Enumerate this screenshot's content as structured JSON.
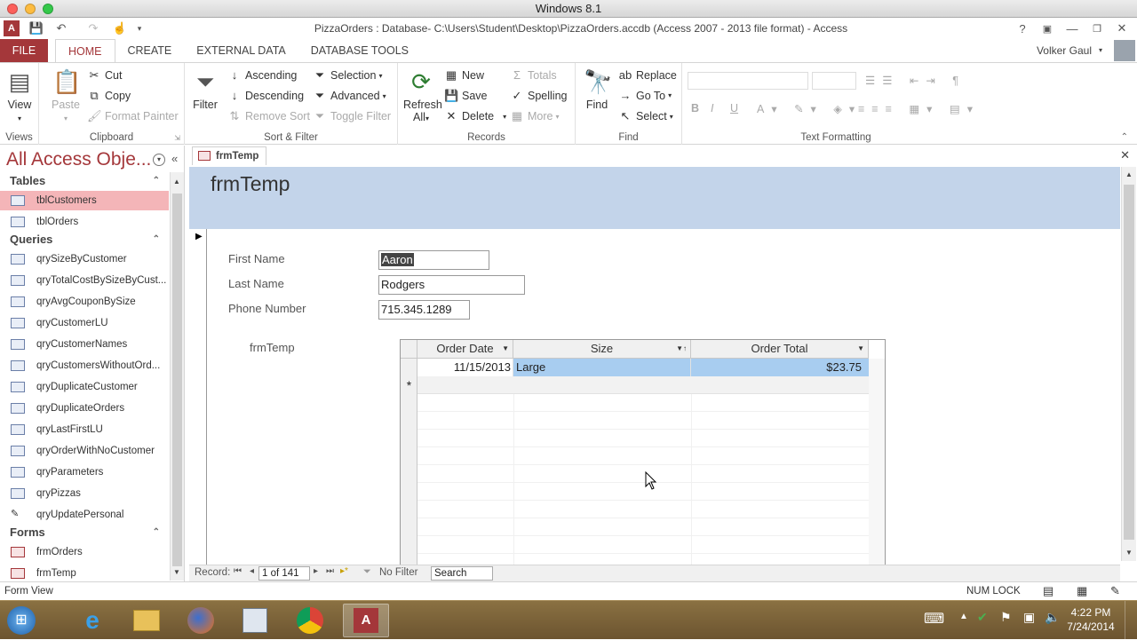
{
  "os_window_title": "Windows 8.1",
  "app_title": "PizzaOrders : Database- C:\\Users\\Student\\Desktop\\PizzaOrders.accdb (Access 2007 - 2013 file format) - Access",
  "user": "Volker Gaul",
  "tabs": [
    "FILE",
    "HOME",
    "CREATE",
    "EXTERNAL DATA",
    "DATABASE TOOLS"
  ],
  "ribbon": {
    "views": {
      "label": "Views",
      "view": "View"
    },
    "clipboard": {
      "label": "Clipboard",
      "paste": "Paste",
      "cut": "Cut",
      "copy": "Copy",
      "format_painter": "Format Painter"
    },
    "sort_filter": {
      "label": "Sort & Filter",
      "filter": "Filter",
      "ascending": "Ascending",
      "descending": "Descending",
      "remove_sort": "Remove Sort",
      "selection": "Selection",
      "advanced": "Advanced",
      "toggle_filter": "Toggle Filter"
    },
    "records": {
      "label": "Records",
      "refresh": "Refresh",
      "refresh2": "All",
      "new": "New",
      "save": "Save",
      "delete": "Delete",
      "totals": "Totals",
      "spelling": "Spelling",
      "more": "More"
    },
    "find": {
      "label": "Find",
      "find": "Find",
      "replace": "Replace",
      "goto": "Go To",
      "select": "Select"
    },
    "text_formatting": {
      "label": "Text Formatting"
    }
  },
  "nav": {
    "title": "All Access Obje...",
    "tables_header": "Tables",
    "tables": [
      "tblCustomers",
      "tblOrders"
    ],
    "queries_header": "Queries",
    "queries": [
      "qrySizeByCustomer",
      "qryTotalCostBySizeByCust...",
      "qryAvgCouponBySize",
      "qryCustomerLU",
      "qryCustomerNames",
      "qryCustomersWithoutOrd...",
      "qryDuplicateCustomer",
      "qryDuplicateOrders",
      "qryLastFirstLU",
      "qryOrderWithNoCustomer",
      "qryParameters",
      "qryPizzas",
      "qryUpdatePersonal"
    ],
    "forms_header": "Forms",
    "forms": [
      "frmOrders",
      "frmTemp"
    ]
  },
  "doc_tab": "frmTemp",
  "form": {
    "title": "frmTemp",
    "first_name_label": "First Name",
    "first_name": "Aaron",
    "last_name_label": "Last Name",
    "last_name": "Rodgers",
    "phone_label": "Phone Number",
    "phone": "715.345.1289",
    "subform_label": "frmTemp",
    "columns": [
      "Order Date",
      "Size",
      "Order Total"
    ],
    "rows": [
      [
        "11/15/2013",
        "Large",
        "$23.75"
      ]
    ],
    "new_row_marker": "*"
  },
  "record_nav": {
    "label": "Record:",
    "current": "1 of 141",
    "filter": "No Filter",
    "search": "Search"
  },
  "status": {
    "left": "Form View",
    "numlock": "NUM LOCK"
  },
  "clock": {
    "time": "4:22 PM",
    "date": "7/24/2014"
  }
}
